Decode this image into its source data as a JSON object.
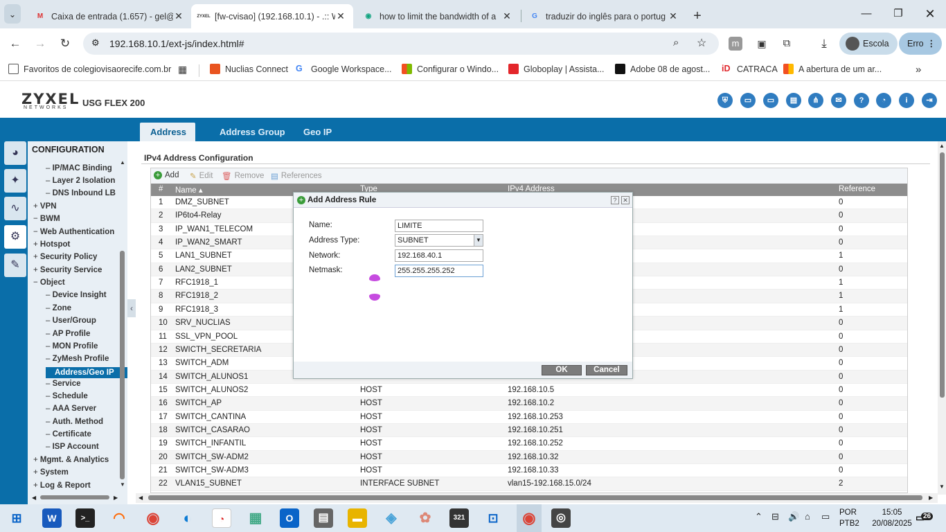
{
  "browser": {
    "tabs": [
      {
        "title": "Caixa de entrada (1.657) - gel@",
        "favicon": "gmail-icon"
      },
      {
        "title": "[fw-cvisao] (192.168.10.1) - .:: W",
        "favicon": "zyxel-icon"
      },
      {
        "title": "how to limit the bandwidth of a",
        "favicon": "chat-icon"
      },
      {
        "title": "traduzir do inglês para o portug",
        "favicon": "google-icon"
      }
    ],
    "url": "192.168.10.1/ext-js/index.html#",
    "profile_label": "Escola",
    "error_label": "Erro",
    "bookmarks": [
      "Favoritos de colegiovisaorecife.com.br",
      "Nuclias Connect",
      "Google Workspace...",
      "Configurar o Windo...",
      "Globoplay | Assista...",
      "Adobe 08 de agost...",
      "CATRACA",
      "A abertura de um ar..."
    ]
  },
  "app": {
    "logo": "ZYXEL",
    "logo_sub": "NETWORKS",
    "model": "USG FLEX 200",
    "tabs": [
      "Address",
      "Address Group",
      "Geo IP"
    ],
    "menu_title": "CONFIGURATION",
    "menu_items": [
      {
        "label": "IP/MAC Binding",
        "level": 2
      },
      {
        "label": "Layer 2 Isolation",
        "level": 2
      },
      {
        "label": "DNS Inbound LB",
        "level": 2
      },
      {
        "label": "VPN",
        "level": 1,
        "sign": "+"
      },
      {
        "label": "BWM",
        "level": 1,
        "sign": "-"
      },
      {
        "label": "Web Authentication",
        "level": 1,
        "sign": "-"
      },
      {
        "label": "Hotspot",
        "level": 1,
        "sign": "+"
      },
      {
        "label": "Security Policy",
        "level": 1,
        "sign": "+"
      },
      {
        "label": "Security Service",
        "level": 1,
        "sign": "+"
      },
      {
        "label": "Object",
        "level": 1,
        "sign": "-"
      },
      {
        "label": "Device Insight",
        "level": 2
      },
      {
        "label": "Zone",
        "level": 2
      },
      {
        "label": "User/Group",
        "level": 2
      },
      {
        "label": "AP Profile",
        "level": 2
      },
      {
        "label": "MON Profile",
        "level": 2
      },
      {
        "label": "ZyMesh Profile",
        "level": 2
      },
      {
        "label": "Address/Geo IP",
        "level": 2,
        "selected": true
      },
      {
        "label": "Service",
        "level": 2
      },
      {
        "label": "Schedule",
        "level": 2
      },
      {
        "label": "AAA Server",
        "level": 2
      },
      {
        "label": "Auth. Method",
        "level": 2
      },
      {
        "label": "Certificate",
        "level": 2
      },
      {
        "label": "ISP Account",
        "level": 2
      },
      {
        "label": "Mgmt. & Analytics",
        "level": 1,
        "sign": "+"
      },
      {
        "label": "System",
        "level": 1,
        "sign": "+"
      },
      {
        "label": "Log & Report",
        "level": 1,
        "sign": "+"
      }
    ],
    "section_title": "IPv4 Address Configuration",
    "toolbar": {
      "add": "Add",
      "edit": "Edit",
      "remove": "Remove",
      "references": "References"
    },
    "columns": [
      "#",
      "Name ▴",
      "Type",
      "IPv4 Address",
      "Reference"
    ],
    "rows": [
      {
        "n": "1",
        "name": "DMZ_SUBNET",
        "type": "",
        "ip": "",
        "ref": "0"
      },
      {
        "n": "2",
        "name": "IP6to4-Relay",
        "type": "",
        "ip": "",
        "ref": "0"
      },
      {
        "n": "3",
        "name": "IP_WAN1_TELECOM",
        "type": "",
        "ip": "",
        "ref": "0"
      },
      {
        "n": "4",
        "name": "IP_WAN2_SMART",
        "type": "",
        "ip": "",
        "ref": "0"
      },
      {
        "n": "5",
        "name": "LAN1_SUBNET",
        "type": "",
        "ip": "",
        "ref": "1"
      },
      {
        "n": "6",
        "name": "LAN2_SUBNET",
        "type": "",
        "ip": "",
        "ref": "0"
      },
      {
        "n": "7",
        "name": "RFC1918_1",
        "type": "",
        "ip": "",
        "ref": "1"
      },
      {
        "n": "8",
        "name": "RFC1918_2",
        "type": "",
        "ip": "",
        "ref": "1"
      },
      {
        "n": "9",
        "name": "RFC1918_3",
        "type": "",
        "ip": "",
        "ref": "1"
      },
      {
        "n": "10",
        "name": "SRV_NUCLIAS",
        "type": "",
        "ip": "",
        "ref": "0"
      },
      {
        "n": "11",
        "name": "SSL_VPN_POOL",
        "type": "",
        "ip": "",
        "ref": "0"
      },
      {
        "n": "12",
        "name": "SWICTH_SECRETARIA",
        "type": "",
        "ip": "",
        "ref": "0"
      },
      {
        "n": "13",
        "name": "SWITCH_ADM",
        "type": "",
        "ip": "",
        "ref": "0"
      },
      {
        "n": "14",
        "name": "SWITCH_ALUNOS1",
        "type": "",
        "ip": "",
        "ref": "0"
      },
      {
        "n": "15",
        "name": "SWITCH_ALUNOS2",
        "type": "HOST",
        "ip": "192.168.10.5",
        "ref": "0"
      },
      {
        "n": "16",
        "name": "SWITCH_AP",
        "type": "HOST",
        "ip": "192.168.10.2",
        "ref": "0"
      },
      {
        "n": "17",
        "name": "SWITCH_CANTINA",
        "type": "HOST",
        "ip": "192.168.10.253",
        "ref": "0"
      },
      {
        "n": "18",
        "name": "SWITCH_CASARAO",
        "type": "HOST",
        "ip": "192.168.10.251",
        "ref": "0"
      },
      {
        "n": "19",
        "name": "SWITCH_INFANTIL",
        "type": "HOST",
        "ip": "192.168.10.252",
        "ref": "0"
      },
      {
        "n": "20",
        "name": "SWITCH_SW-ADM2",
        "type": "HOST",
        "ip": "192.168.10.32",
        "ref": "0"
      },
      {
        "n": "21",
        "name": "SWITCH_SW-ADM3",
        "type": "HOST",
        "ip": "192.168.10.33",
        "ref": "0"
      },
      {
        "n": "22",
        "name": "VLAN15_SUBNET",
        "type": "INTERFACE SUBNET",
        "ip": "vlan15-192.168.15.0/24",
        "ref": "2"
      }
    ]
  },
  "dialog": {
    "title": "Add Address Rule",
    "name_label": "Name:",
    "name_value": "LIMITE",
    "type_label": "Address Type:",
    "type_value": "SUBNET",
    "network_label": "Network:",
    "network_value": "192.168.40.1",
    "netmask_label": "Netmask:",
    "netmask_value": "255.255.255.252",
    "ok": "OK",
    "cancel": "Cancel"
  },
  "taskbar": {
    "lang_line1": "POR",
    "lang_line2": "PTB2",
    "time": "15:05",
    "date": "20/08/2025",
    "notif_count": "26"
  }
}
